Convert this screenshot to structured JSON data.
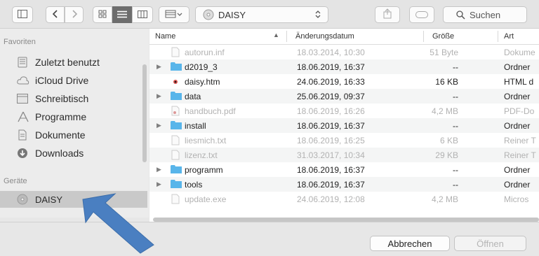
{
  "toolbar": {
    "location": "DAISY",
    "search_placeholder": "Suchen"
  },
  "sidebar": {
    "favorites_title": "Favoriten",
    "favorites": [
      {
        "label": "Zuletzt benutzt",
        "icon": "recents-icon"
      },
      {
        "label": "iCloud Drive",
        "icon": "cloud-icon"
      },
      {
        "label": "Schreibtisch",
        "icon": "desktop-icon"
      },
      {
        "label": "Programme",
        "icon": "applications-icon"
      },
      {
        "label": "Dokumente",
        "icon": "documents-icon"
      },
      {
        "label": "Downloads",
        "icon": "downloads-icon"
      }
    ],
    "devices_title": "Geräte",
    "devices": [
      {
        "label": "DAISY",
        "icon": "disc-icon"
      }
    ]
  },
  "columns": {
    "name": "Name",
    "date": "Änderungsdatum",
    "size": "Größe",
    "type": "Art"
  },
  "files": [
    {
      "name": "autorun.inf",
      "date": "18.03.2014, 10:30",
      "size": "51 Byte",
      "type": "Dokume",
      "kind": "file",
      "enabled": false
    },
    {
      "name": "d2019_3",
      "date": "18.06.2019, 16:37",
      "size": "--",
      "type": "Ordner",
      "kind": "folder",
      "enabled": true
    },
    {
      "name": "daisy.htm",
      "date": "24.06.2019, 16:33",
      "size": "16 KB",
      "type": "HTML d",
      "kind": "html",
      "enabled": true
    },
    {
      "name": "data",
      "date": "25.06.2019, 09:37",
      "size": "--",
      "type": "Ordner",
      "kind": "folder",
      "enabled": true
    },
    {
      "name": "handbuch.pdf",
      "date": "18.06.2019, 16:26",
      "size": "4,2 MB",
      "type": "PDF-Do",
      "kind": "pdf",
      "enabled": false
    },
    {
      "name": "install",
      "date": "18.06.2019, 16:37",
      "size": "--",
      "type": "Ordner",
      "kind": "folder",
      "enabled": true
    },
    {
      "name": "liesmich.txt",
      "date": "18.06.2019, 16:25",
      "size": "6 KB",
      "type": "Reiner T",
      "kind": "file",
      "enabled": false
    },
    {
      "name": "lizenz.txt",
      "date": "31.03.2017, 10:34",
      "size": "29 KB",
      "type": "Reiner T",
      "kind": "file",
      "enabled": false
    },
    {
      "name": "programm",
      "date": "18.06.2019, 16:37",
      "size": "--",
      "type": "Ordner",
      "kind": "folder",
      "enabled": true
    },
    {
      "name": "tools",
      "date": "18.06.2019, 16:37",
      "size": "--",
      "type": "Ordner",
      "kind": "folder",
      "enabled": true
    },
    {
      "name": "update.exe",
      "date": "24.06.2019, 12:08",
      "size": "4,2 MB",
      "type": "Micros",
      "kind": "file",
      "enabled": false
    }
  ],
  "buttons": {
    "cancel": "Abbrechen",
    "open": "Öffnen"
  },
  "colors": {
    "folder": "#58b5ea",
    "arrow": "#4a7fc1"
  }
}
